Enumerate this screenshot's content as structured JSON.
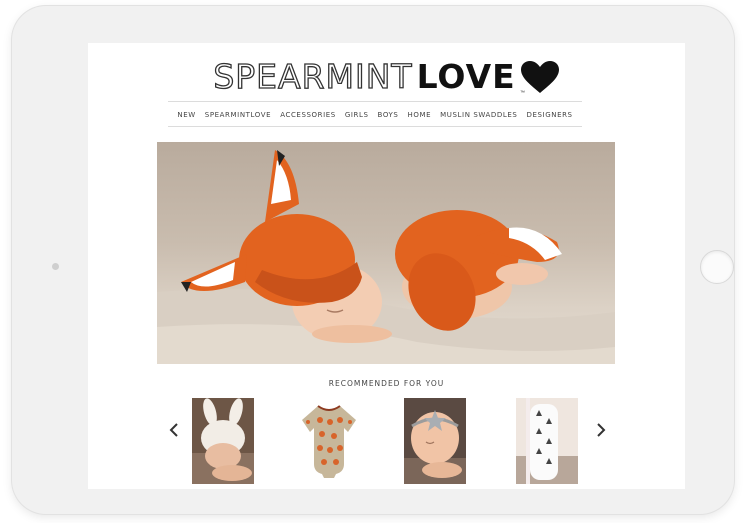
{
  "site": {
    "logo_outline": "SPEARMINT",
    "logo_solid": "LOVE",
    "logo_tm": "™"
  },
  "nav": {
    "items": [
      "NEW",
      "SPEARMINTLOVE",
      "ACCESSORIES",
      "GIRLS",
      "BOYS",
      "HOME",
      "MUSLIN SWADDLES",
      "DESIGNERS"
    ]
  },
  "hero": {
    "image": "baby-in-knit-fox-hat-and-pants"
  },
  "recommended": {
    "title": "RECOMMENDED FOR YOU",
    "prev_icon": "chevron-left-icon",
    "next_icon": "chevron-right-icon",
    "products": [
      {
        "image": "baby-in-white-bunny-hat"
      },
      {
        "image": "fox-print-onesie"
      },
      {
        "image": "baby-with-star-headband"
      },
      {
        "image": "swaddle-blanket-roll"
      }
    ]
  },
  "colors": {
    "hat_orange": "#e2631f",
    "text_dark": "#111111",
    "nav_text": "#444444"
  }
}
